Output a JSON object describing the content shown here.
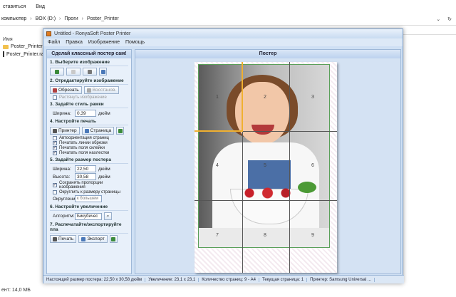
{
  "explorer": {
    "menu": [
      "ставиться",
      "Вид"
    ],
    "breadcrumbs": [
      "компьютер",
      "BOX (D:)",
      "Проги",
      "Poster_Printer"
    ],
    "left_header": "Имя",
    "files": [
      {
        "name": "Poster_Printer",
        "icon": "folder-icon"
      },
      {
        "name": "Poster_Printer.rar",
        "icon": "rar-icon"
      }
    ],
    "status": "ент: 14,0 МБ"
  },
  "app": {
    "title": "Untitled - RonyaSoft Poster Printer",
    "menu": [
      "Файл",
      "Правка",
      "Изображение",
      "Помощь"
    ],
    "left_panel_title": "Сделай классный постер сам!",
    "right_panel_title": "Постер",
    "sections": {
      "s1": "1. Выберите изображение",
      "s2": "2. Отредактируйте изображение",
      "s2_crop": "Обрезать",
      "s2_restore": "Восстанов.",
      "s2_fit": "Растянуть изображение",
      "s3": "3. Задайте стиль рамки",
      "s3_width_label": "Ширина:",
      "s3_width_value": "0,39",
      "s3_unit": "дюйм",
      "s4": "4. Настройте печать",
      "s4_printer": "Принтер",
      "s4_page": "Страница",
      "s4_opts": [
        {
          "label": "Автоориентация страниц",
          "checked": false
        },
        {
          "label": "Печатать линии обрезки",
          "checked": true
        },
        {
          "label": "Печатать поля склейки",
          "checked": true
        },
        {
          "label": "Печатать поля нахлестки",
          "checked": true
        }
      ],
      "s5": "5. Задайте размер постера",
      "s5_width_label": "Ширина:",
      "s5_width_value": "22,50",
      "s5_height_label": "Высота:",
      "s5_height_value": "30,58",
      "s5_unit": "дюйм",
      "s5_keep": "Сохранять пропорции изображения",
      "s5_round": "Округлить к размеру страницы",
      "s5_round_label": "Округление:",
      "s5_round_value": "к большем",
      "s6": "6. Настройте увеличение",
      "s6_algo_label": "Алгоритм:",
      "s6_algo_value": "Бикубичес",
      "s7": "7. Распечатайте/экспортируйте пла",
      "s7_print": "Печать",
      "s7_export": "Экспорт"
    },
    "pages": [
      "1",
      "2",
      "3",
      "4",
      "5",
      "6",
      "7",
      "8",
      "9"
    ],
    "status": [
      "Настоящий размер постера: 22,50 x 30,58 дюйм",
      "Увеличение: 23,1 x 23,1",
      "Количество страниц: 9 - A4",
      "Текущая страница: 1",
      "Принтер: Samsung Universal ..."
    ]
  }
}
